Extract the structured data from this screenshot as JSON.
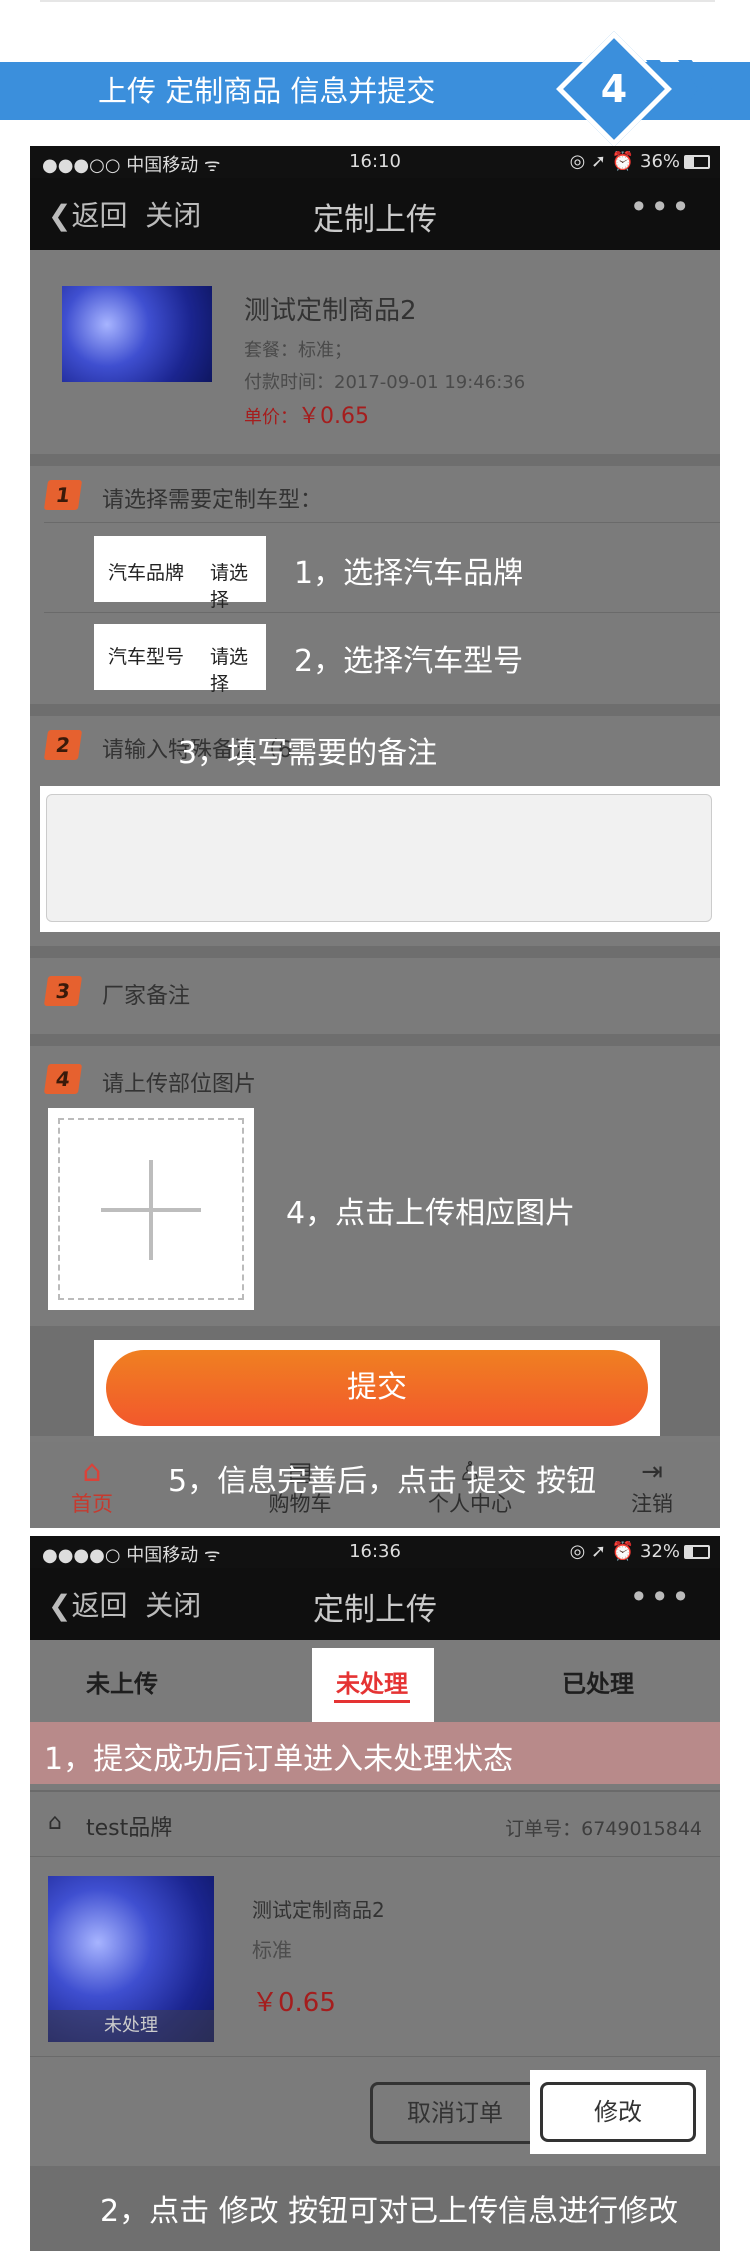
{
  "banner": {
    "title": "上传 定制商品 信息并提交",
    "step": "4"
  },
  "shot1": {
    "status": {
      "carrier": "●●●○○ 中国移动 ᯤ",
      "time": "16:10",
      "right": "◎ ➚ ⏰ 36%"
    },
    "nav": {
      "back": "❮返回",
      "close": "关闭",
      "title": "定制上传",
      "more": "•••"
    },
    "product": {
      "name": "测试定制商品2",
      "package": "套餐：标准；",
      "paytime": "付款时间：2017-09-01 19:46:36",
      "price_label": "单价：",
      "price": "￥0.65"
    },
    "sections": {
      "s1": {
        "num": "1",
        "title": "请选择需要定制车型："
      },
      "s2": {
        "num": "2",
        "title": "请输入特殊备注（6"
      },
      "s3": {
        "num": "3",
        "title": "厂家备注"
      },
      "s4": {
        "num": "4",
        "title": "请上传部位图片"
      }
    },
    "brand": {
      "label": "汽车品牌",
      "value": "请选择"
    },
    "model": {
      "label": "汽车型号",
      "value": "请选择"
    },
    "annotations": {
      "a1": "1，选择汽车品牌",
      "a2": "2，选择汽车型号",
      "a3": "3，填写需要的备注",
      "a4": "4，点击上传相应图片",
      "a5": "5，信息完善后，点击 提交 按钮"
    },
    "submit": "提交",
    "tabbar": [
      {
        "label": "首页",
        "icon": "home-icon"
      },
      {
        "label": "购物车",
        "icon": "cart-icon"
      },
      {
        "label": "个人中心",
        "icon": "user-icon"
      },
      {
        "label": "注销",
        "icon": "logout-icon"
      }
    ],
    "colors": {
      "accent": "#f2582c",
      "badge": "#e6612f",
      "price": "#a51d1d"
    }
  },
  "shot2": {
    "status": {
      "carrier": "●●●●○ 中国移动 ᯤ",
      "time": "16:36",
      "right": "◎ ➚ ⏰ 32%"
    },
    "nav": {
      "back": "❮返回",
      "close": "关闭",
      "title": "定制上传",
      "more": "•••"
    },
    "tabs": [
      {
        "label": "未上传"
      },
      {
        "label": "未处理"
      },
      {
        "label": "已处理"
      }
    ],
    "annotation1": "1，提交成功后订单进入未处理状态",
    "order": {
      "brand": "test品牌",
      "order_no": "订单号：6749015844",
      "name": "测试定制商品2",
      "package": "标准",
      "price": "￥0.65",
      "status_overlay": "未处理"
    },
    "buttons": {
      "cancel": "取消订单",
      "modify": "修改"
    },
    "annotation2": "2，点击 修改 按钮可对已上传信息进行修改"
  }
}
